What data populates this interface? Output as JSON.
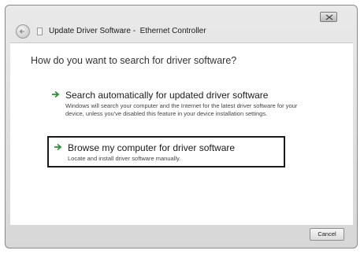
{
  "window": {
    "title": "Update Driver Software -  Ethernet Controller"
  },
  "main": {
    "question": "How do you want to search for driver software?",
    "options": [
      {
        "title": "Search automatically for updated driver software",
        "description": "Windows will search your computer and the Internet for the latest driver software for your device, unless you've disabled this feature in your device installation settings."
      },
      {
        "title": "Browse my computer for driver software",
        "description": "Locate and install driver software manually."
      }
    ]
  },
  "footer": {
    "cancel_label": "Cancel"
  },
  "icons": {
    "back": "back-arrow-icon",
    "app": "driver-app-icon",
    "close": "close-icon",
    "option_arrow": "green-arrow-icon"
  },
  "colors": {
    "option_arrow": "#2f8f3a",
    "highlight_border": "#1a1a1a"
  }
}
